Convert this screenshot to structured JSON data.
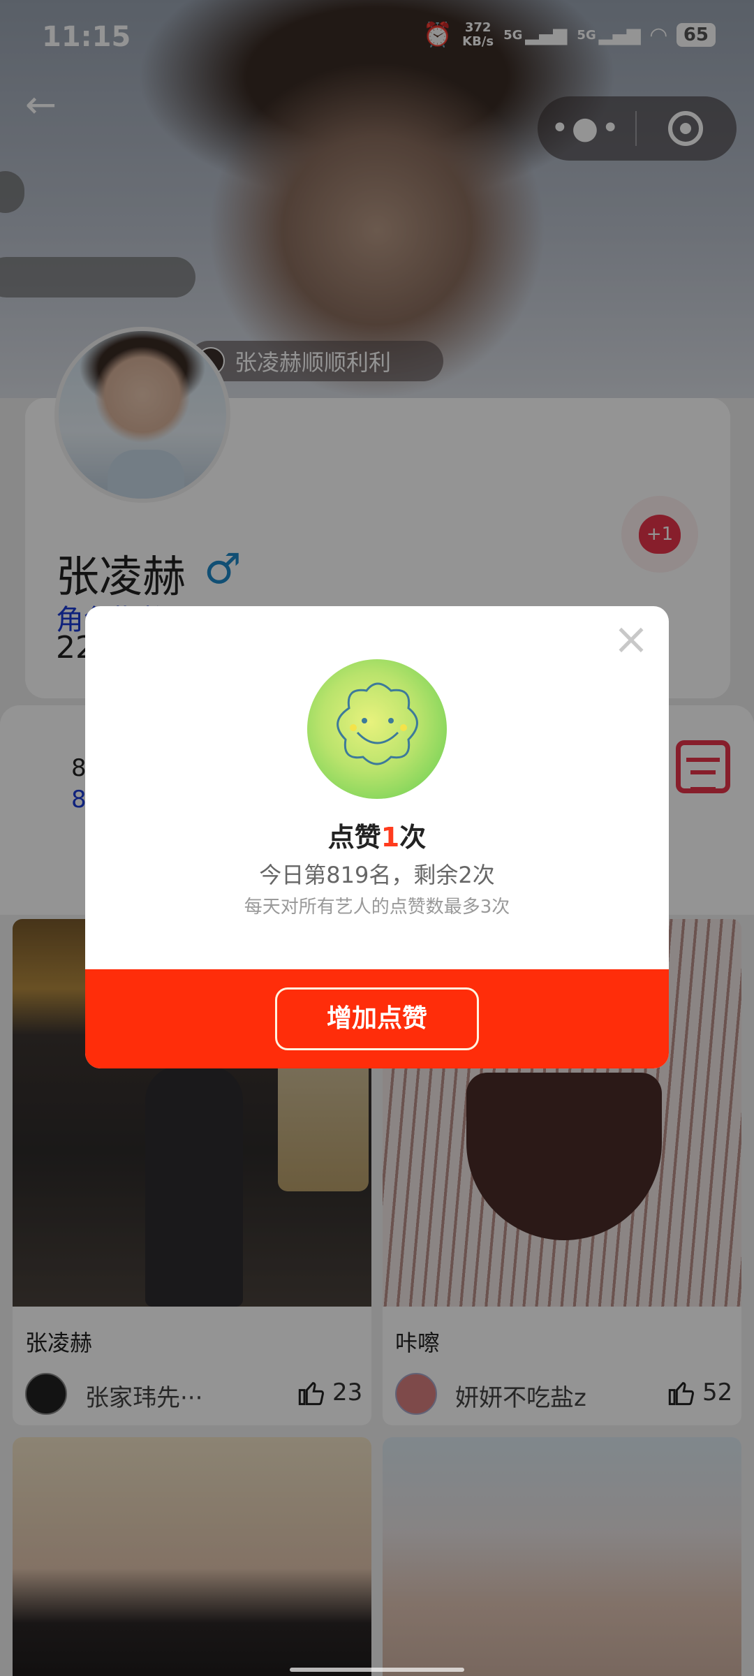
{
  "status_bar": {
    "time": "11:15",
    "net_speed_value": "372",
    "net_speed_unit": "KB/s",
    "signal1": "5G",
    "signal2": "5G",
    "battery": "65"
  },
  "header": {
    "owner_tag": "张凌赫顺顺利利"
  },
  "profile": {
    "name": "张凌赫",
    "gender_symbol": "♂",
    "stat_label": "角色指数",
    "stat_value": "22",
    "like_badge": "+1"
  },
  "rank": {
    "line1": "8",
    "line2": "8"
  },
  "posts": [
    {
      "title": "张凌赫",
      "author": "张家玮先···",
      "likes": "23"
    },
    {
      "title": "咔嚓",
      "author": "妍妍不吃盐z",
      "likes": "52"
    },
    {
      "title": "",
      "author": "",
      "likes": ""
    },
    {
      "title": "",
      "author": "",
      "likes": ""
    }
  ],
  "modal": {
    "title_prefix": "点赞",
    "title_count": "1",
    "title_suffix": "次",
    "subtitle": "今日第819名，剩余2次",
    "note": "每天对所有艺人的点赞数最多3次",
    "button_label": "增加点赞",
    "close_label": "×"
  },
  "colors": {
    "accent": "#ff2d0a",
    "stat_blue": "#1a3bd6",
    "heart_red": "#e8354a",
    "male_blue": "#1e88c9"
  }
}
